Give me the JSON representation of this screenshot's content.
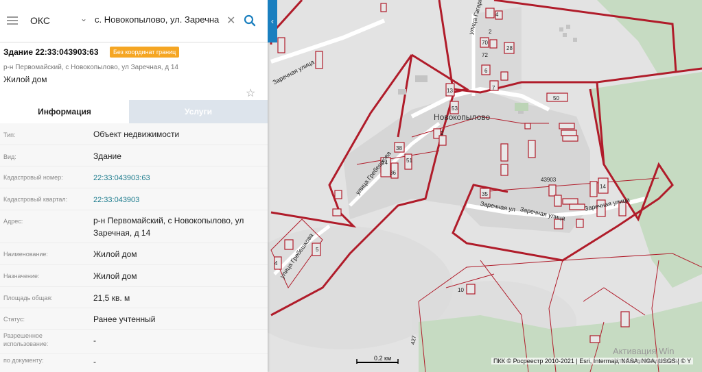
{
  "search": {
    "type_value": "ОКС",
    "query_value": "с. Новокопылово, ул. Заречна"
  },
  "object": {
    "title": "Здание 22:33:043903:63",
    "badge": "Без координат границ",
    "address": "р-н Первомайский, с Новокопылово, ул Заречная, д 14",
    "type_text": "Жилой дом"
  },
  "tabs": {
    "info": "Информация",
    "services": "Услуги"
  },
  "rows": [
    {
      "key": "Тип:",
      "value": "Объект недвижимости"
    },
    {
      "key": "Вид:",
      "value": "Здание"
    },
    {
      "key": "Кадастровый номер:",
      "value": "22:33:043903:63"
    },
    {
      "key": "Кадастровый квартал:",
      "value": "22:33:043903"
    },
    {
      "key": "Адрес:",
      "value": "р-н Первомайский, с Новокопылово, ул Заречная, д 14"
    },
    {
      "key": "Наименование:",
      "value": "Жилой дом"
    },
    {
      "key": "Назначение:",
      "value": "Жилой дом"
    },
    {
      "key": "Площадь общая:",
      "value": "21,5 кв. м"
    },
    {
      "key": "Статус:",
      "value": "Ранее учтенный"
    },
    {
      "key": "Разрешенное использование:",
      "value": "-"
    },
    {
      "key": "по документу:",
      "value": "-"
    }
  ],
  "map": {
    "place_name": "Новокопылово",
    "streets": {
      "zarechnaya_top": "Заречная улица",
      "grebeshkova_upper": "улица Гребешкова",
      "grebeshkova_lower": "улица Гребешкова",
      "gagarina": "улица Гагарина",
      "zarechnaya_a": "Заречная ул",
      "zarechnaya_b": "Заречная улица",
      "zarechnaya_c": "Заречная улица"
    },
    "numbers": {
      "n4": "4",
      "n2": "2",
      "n70": "70",
      "n72": "72",
      "n28": "28",
      "n6": "6",
      "n7": "7",
      "n50": "50",
      "n13": "13",
      "n53": "53",
      "n2b": "2",
      "n38": "38",
      "n14": "14",
      "n51": "51",
      "n36": "36",
      "n43903": "43903",
      "n14b": "14",
      "n35": "35",
      "n10": "10",
      "n427": "427",
      "n4b": "4",
      "n5": "5"
    },
    "scale": "0.2 км",
    "attribution": "ПКК © Росреестр 2010-2021 | Esri, Intermap, NASA, NGA, USGS | © Y",
    "watermark_line1": "Активация Win",
    "watermark_line2": "Чтобы активировать"
  },
  "colors": {
    "boundary": "#b01c2a",
    "forest": "#c8dcc4",
    "badge": "#f5a623",
    "accent": "#1a7fbf",
    "link": "#1a7a8c"
  }
}
